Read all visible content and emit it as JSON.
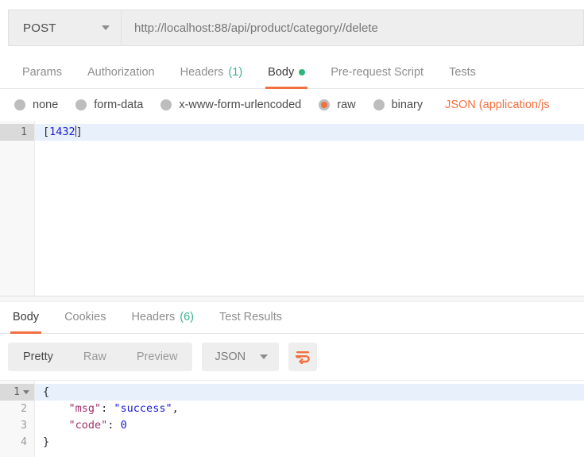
{
  "request": {
    "method": "POST",
    "url": "http://localhost:88/api/product/category//delete",
    "tabs": [
      {
        "label": "Params",
        "count": "",
        "active": false
      },
      {
        "label": "Authorization",
        "count": "",
        "active": false
      },
      {
        "label": "Headers",
        "count": "(1)",
        "active": false
      },
      {
        "label": "Body",
        "count": "",
        "active": true
      },
      {
        "label": "Pre-request Script",
        "count": "",
        "active": false
      },
      {
        "label": "Tests",
        "count": "",
        "active": false
      }
    ],
    "body_types": [
      {
        "label": "none",
        "selected": false
      },
      {
        "label": "form-data",
        "selected": false
      },
      {
        "label": "x-www-form-urlencoded",
        "selected": false
      },
      {
        "label": "raw",
        "selected": true
      },
      {
        "label": "binary",
        "selected": false
      }
    ],
    "content_type": "JSON (application/js",
    "editor": {
      "line_numbers": [
        "1"
      ],
      "code_open": "[",
      "code_value": "1432",
      "code_close": "]"
    }
  },
  "response": {
    "tabs": [
      {
        "label": "Body",
        "count": "",
        "active": true
      },
      {
        "label": "Cookies",
        "count": "",
        "active": false
      },
      {
        "label": "Headers",
        "count": "(6)",
        "active": false
      },
      {
        "label": "Test Results",
        "count": "",
        "active": false
      }
    ],
    "view_modes": [
      {
        "label": "Pretty",
        "active": true
      },
      {
        "label": "Raw",
        "active": false
      },
      {
        "label": "Preview",
        "active": false
      }
    ],
    "format": "JSON",
    "wrap_icon": "word-wrap-icon",
    "editor": {
      "line_numbers": [
        "1",
        "2",
        "3",
        "4"
      ],
      "lines": [
        {
          "text": "{",
          "type": "punct"
        },
        {
          "key": "\"msg\"",
          "sep": ": ",
          "value": "\"success\"",
          "tail": ","
        },
        {
          "key": "\"code\"",
          "sep": ": ",
          "value": "0",
          "tail": ""
        },
        {
          "text": "}",
          "type": "punct"
        }
      ]
    }
  },
  "colors": {
    "accent": "#f2703f",
    "green": "#2cb67d",
    "key": "#a0306a",
    "string": "#1a1ad4",
    "highlight": "#e8f0fb"
  }
}
